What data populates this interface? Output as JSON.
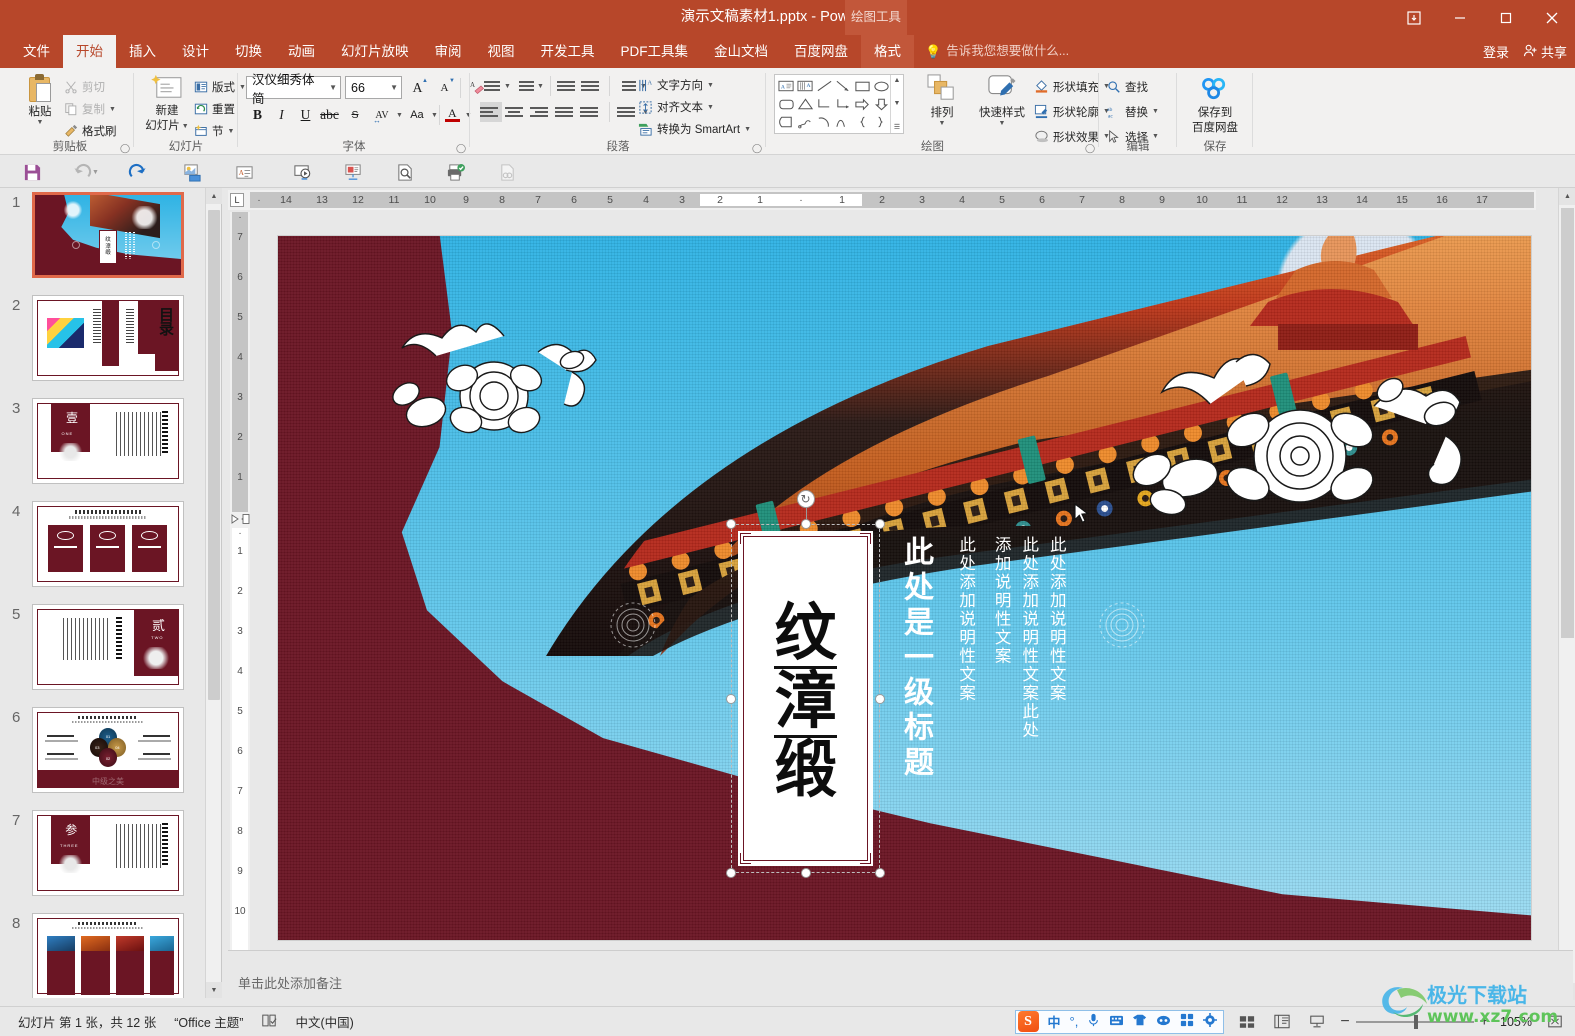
{
  "window": {
    "document_title": "演示文稿素材1.pptx - PowerPoint",
    "contextual_tab_group": "绘图工具",
    "ribbon_display_icon": "ribbon-display-options-icon",
    "minimize_icon": "minimize-icon",
    "restore_icon": "restore-icon",
    "close_icon": "close-icon"
  },
  "tabs": [
    {
      "label": "文件",
      "state": "normal"
    },
    {
      "label": "开始",
      "state": "active"
    },
    {
      "label": "插入",
      "state": "normal"
    },
    {
      "label": "设计",
      "state": "normal"
    },
    {
      "label": "切换",
      "state": "normal"
    },
    {
      "label": "动画",
      "state": "normal"
    },
    {
      "label": "幻灯片放映",
      "state": "normal"
    },
    {
      "label": "审阅",
      "state": "normal"
    },
    {
      "label": "视图",
      "state": "normal"
    },
    {
      "label": "开发工具",
      "state": "normal"
    },
    {
      "label": "PDF工具集",
      "state": "normal"
    },
    {
      "label": "金山文档",
      "state": "normal"
    },
    {
      "label": "百度网盘",
      "state": "normal"
    },
    {
      "label": "格式",
      "state": "contextual"
    }
  ],
  "tell_me": {
    "placeholder": "告诉我您想要做什么...",
    "icon": "lightbulb-icon"
  },
  "account": {
    "sign_in": "登录",
    "share": "共享",
    "share_icon": "share-person-icon"
  },
  "ribbon": {
    "clipboard": {
      "group_label": "剪贴板",
      "paste": "粘贴",
      "cut": "剪切",
      "copy": "复制",
      "format_painter": "格式刷"
    },
    "slides": {
      "group_label": "幻灯片",
      "new_slide_line1": "新建",
      "new_slide_line2": "幻灯片",
      "layout": "版式",
      "reset": "重置",
      "section": "节"
    },
    "font": {
      "group_label": "字体",
      "font_name": "汉仪细秀体简",
      "font_size": "66",
      "grow_font": "A",
      "shrink_font": "A",
      "clear_format_icon": "clear-formatting-icon",
      "bold": "B",
      "italic": "I",
      "underline": "U",
      "strikethrough": "S",
      "shadow": "abc",
      "char_spacing": "AV",
      "change_case": "Aa",
      "font_color_icon": "font-color-icon"
    },
    "paragraph": {
      "group_label": "段落",
      "text_direction": "文字方向",
      "align_text": "对齐文本",
      "convert_smartart": "转换为 SmartArt"
    },
    "drawing": {
      "group_label": "绘图",
      "arrange": "排列",
      "quick_styles": "快速样式",
      "shape_fill": "形状填充",
      "shape_outline": "形状轮廓",
      "shape_effects": "形状效果"
    },
    "editing": {
      "group_label": "编辑",
      "find": "查找",
      "replace": "替换",
      "select": "选择"
    },
    "save": {
      "group_label": "保存",
      "baidu_line1": "保存到",
      "baidu_line2": "百度网盘"
    }
  },
  "quick_access": [
    {
      "name": "save-icon"
    },
    {
      "name": "undo-icon"
    },
    {
      "name": "redo-icon"
    },
    {
      "name": "start-from-beginning-icon"
    },
    {
      "name": "insert-textbox-icon"
    },
    {
      "name": "start-slideshow-icon"
    },
    {
      "name": "presenter-view-icon"
    },
    {
      "name": "print-preview-icon"
    },
    {
      "name": "print-icon"
    },
    {
      "name": "hyperlink-icon"
    }
  ],
  "ruler": {
    "horizontal_left": [
      "14",
      "13",
      "12",
      "11",
      "10",
      "9",
      "8",
      "7",
      "6",
      "5",
      "4",
      "3"
    ],
    "horizontal_right": [
      "1",
      "2",
      "3",
      "4",
      "5",
      "6",
      "7",
      "8",
      "9",
      "10",
      "11",
      "12",
      "13",
      "14",
      "15",
      "16",
      "17"
    ],
    "horizontal_inside": [
      "2",
      "1",
      "1"
    ],
    "vertical_top": [
      "7",
      "6",
      "5",
      "4",
      "3",
      "2",
      "1"
    ],
    "vertical_bottom": [
      "1",
      "2",
      "3",
      "4",
      "5",
      "6",
      "7",
      "8",
      "9",
      "10"
    ],
    "tab_stop_marker": "L"
  },
  "thumbnails": [
    {
      "number": "1",
      "selected": true
    },
    {
      "number": "2",
      "selected": false
    },
    {
      "number": "3",
      "selected": false
    },
    {
      "number": "4",
      "selected": false
    },
    {
      "number": "5",
      "selected": false
    },
    {
      "number": "6",
      "selected": false
    },
    {
      "number": "7",
      "selected": false
    },
    {
      "number": "8",
      "selected": false
    }
  ],
  "slide": {
    "title_chars": [
      "纹",
      "漳",
      "缎"
    ],
    "heading_vertical": "此处是一级标题",
    "body_columns": [
      "此处添加说明性文案",
      "此处添加说明性文案此处",
      "添加说明性文案",
      "此处添加说明性文案"
    ],
    "colors": {
      "background_red": "#6b1524",
      "sky_blue": "#2fb3e4",
      "title_box_white": "#ffffff"
    },
    "selection": {
      "rotate_handle": "rotate-handle-icon",
      "handles": 8
    }
  },
  "notes": {
    "placeholder": "单击此处添加备注"
  },
  "status": {
    "slide_counter": "幻灯片 第 1 张，共 12 张",
    "theme": "“Office 主题”",
    "spellcheck_icon": "spellcheck-icon",
    "language": "中文(中国)",
    "zoom_level": "105%",
    "zoom_out": "−",
    "zoom_in": "+",
    "fit_slide_icon": "fit-slide-to-window-icon",
    "views": [
      {
        "name": "normal-view-icon"
      },
      {
        "name": "slide-sorter-view-icon"
      },
      {
        "name": "reading-view-icon"
      }
    ]
  },
  "ime": {
    "logo": "S",
    "mode": "中",
    "items": [
      {
        "name": "punctuation-icon"
      },
      {
        "name": "microphone-icon"
      },
      {
        "name": "soft-keyboard-icon"
      },
      {
        "name": "skin-icon"
      },
      {
        "name": "emoji-icon"
      },
      {
        "name": "toolbox-icon"
      },
      {
        "name": "settings-icon"
      }
    ]
  },
  "watermark": {
    "site_name": "极光下载站",
    "url": "www.xz7.com"
  }
}
